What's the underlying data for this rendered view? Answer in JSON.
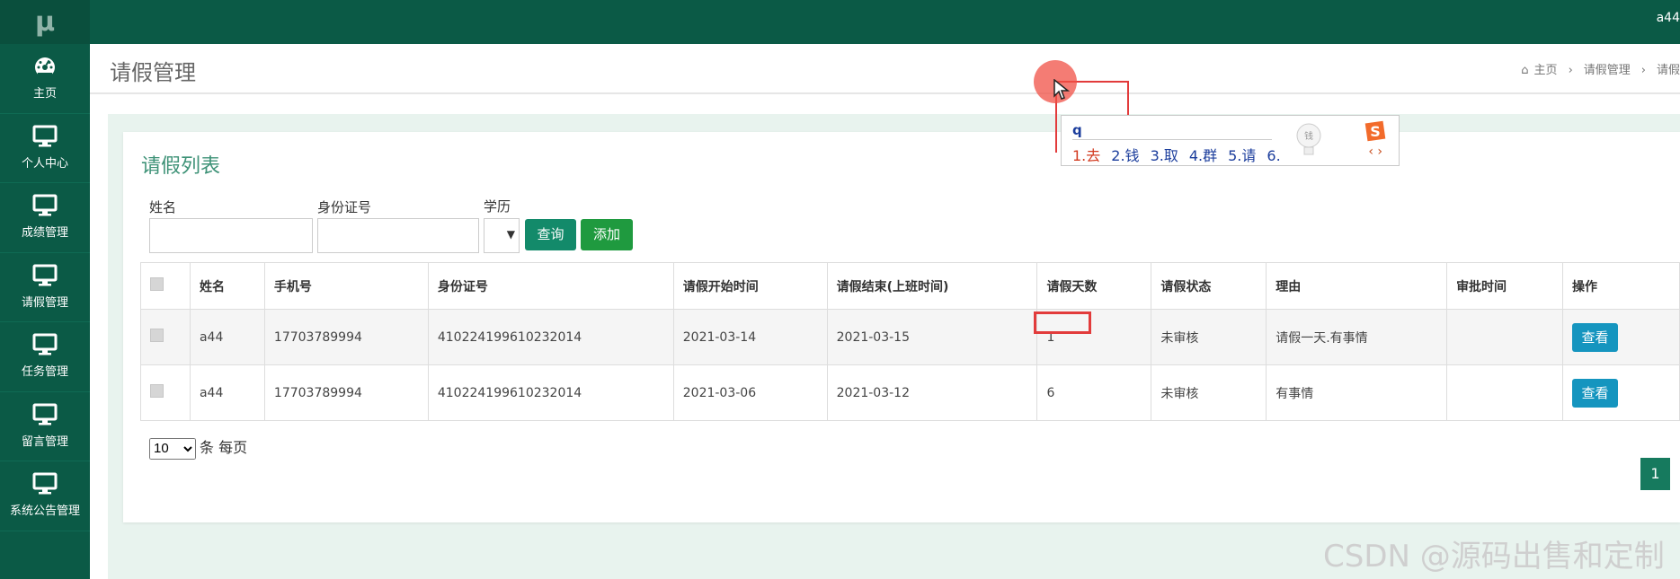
{
  "app": {
    "logo": "μ",
    "user": "a44"
  },
  "sidebar": {
    "items": [
      {
        "label": "主页",
        "icon": "dashboard-icon"
      },
      {
        "label": "个人中心",
        "icon": "monitor-icon"
      },
      {
        "label": "成绩管理",
        "icon": "monitor-icon"
      },
      {
        "label": "请假管理",
        "icon": "monitor-icon"
      },
      {
        "label": "任务管理",
        "icon": "monitor-icon"
      },
      {
        "label": "留言管理",
        "icon": "monitor-icon"
      },
      {
        "label": "系统公告管理",
        "icon": "monitor-icon"
      }
    ]
  },
  "header": {
    "title": "请假管理",
    "breadcrumb": {
      "home": "主页",
      "sep": "›",
      "current": "请假管理",
      "tail": "请假"
    }
  },
  "list": {
    "title": "请假列表",
    "filters": {
      "name_label": "姓名",
      "id_label": "身份证号",
      "edu_label": "学历"
    },
    "buttons": {
      "query": "查询",
      "add": "添加"
    },
    "columns": [
      "姓名",
      "手机号",
      "身份证号",
      "请假开始时间",
      "请假结束(上班时间)",
      "请假天数",
      "请假状态",
      "理由",
      "审批时间",
      "操作"
    ],
    "rows": [
      {
        "name": "a44",
        "phone": "17703789994",
        "id": "410224199610232014",
        "start": "2021-03-14",
        "end": "2021-03-15",
        "days": "1",
        "status": "未审核",
        "reason": "请假一天.有事情",
        "approve_time": "",
        "action": "查看"
      },
      {
        "name": "a44",
        "phone": "17703789994",
        "id": "410224199610232014",
        "start": "2021-03-06",
        "end": "2021-03-12",
        "days": "6",
        "status": "未审核",
        "reason": "有事情",
        "approve_time": "",
        "action": "查看"
      }
    ],
    "pager": {
      "page_size": "10",
      "page_size_suffix": "条 每页",
      "current_page": "1"
    }
  },
  "ime": {
    "input": "q",
    "candidates": [
      "1.去",
      "2.钱",
      "3.取",
      "4.群",
      "5.请",
      "6."
    ],
    "bulb_text": "钱",
    "arrows": "‹ ›"
  },
  "watermark": "CSDN @源码出售和定制",
  "colors": {
    "brand": "#0b5a46",
    "accent_green": "#3e9277",
    "view_button": "#1595bf",
    "annotation_red": "#e23b3b"
  }
}
